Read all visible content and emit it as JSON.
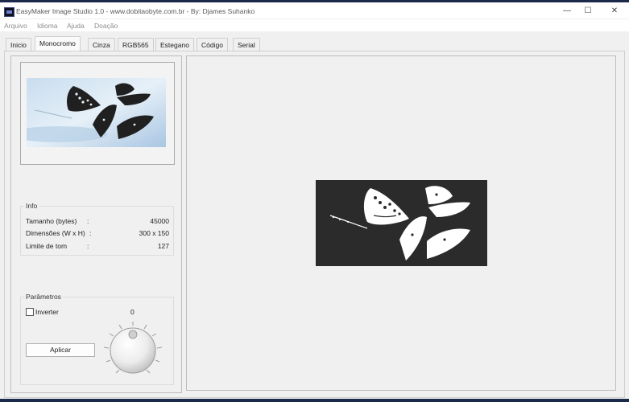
{
  "window": {
    "title": "EasyMaker Image Studio 1.0 - www.dobitaobyte.com.br - By: Djames Suhanko",
    "minimize_glyph": "—",
    "maximize_glyph": "☐",
    "close_glyph": "✕"
  },
  "menu": [
    "Arquivo",
    "Idioma",
    "Ajuda",
    "Doação"
  ],
  "tabs": [
    {
      "label": "Inicio"
    },
    {
      "label": "Monocromo",
      "active": true
    },
    {
      "label": "Cinza"
    },
    {
      "label": "RGB565"
    },
    {
      "label": "Estegano"
    },
    {
      "label": "Código"
    },
    {
      "label": "Serial"
    }
  ],
  "info": {
    "title": "Info",
    "rows": [
      {
        "label": "Tamanho (bytes)",
        "sep": ":",
        "value": "45000"
      },
      {
        "label": "Dimensões (W x H)",
        "sep": ":",
        "value": "300 x 150"
      },
      {
        "label": "Limite de tom",
        "sep": ":",
        "value": "127"
      }
    ]
  },
  "params": {
    "title": "Parâmetros",
    "invert_label": "Inverter",
    "invert_checked": false,
    "knob_value": "0",
    "apply_label": "Aplicar"
  },
  "colors": {
    "accent": "#1b2a4a",
    "preview_bg": "#2b2b2b"
  }
}
